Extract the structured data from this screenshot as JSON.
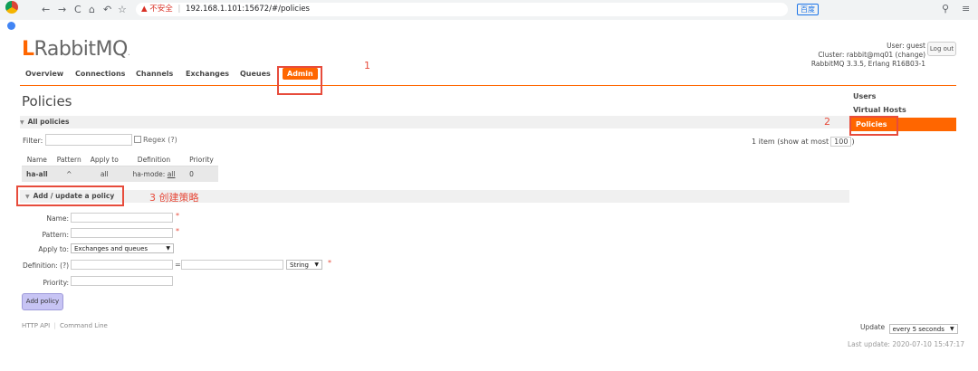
{
  "browser": {
    "nav_icons": [
      "←",
      "→",
      "C",
      "⌂",
      "↶",
      "☆"
    ],
    "warning": "▲ 不安全",
    "url": "192.168.1.101:15672/#/policies",
    "search_engine": "百度"
  },
  "logo": {
    "first": "L",
    "brand": "Rabbit",
    "mq": "MQ",
    "dot": "."
  },
  "user": {
    "line1": "User: guest",
    "line2": "Cluster: rabbit@mq01 (change)",
    "line3": "RabbitMQ 3.3.5, Erlang R16B03-1",
    "logout_label": "Log out"
  },
  "tabs": [
    "Overview",
    "Connections",
    "Channels",
    "Exchanges",
    "Queues",
    "Admin"
  ],
  "page_title": "Policies",
  "all_policies": {
    "header": "All policies",
    "filter_label": "Filter:",
    "regex_label": "Regex (?)",
    "items_text": "1 item (show at most",
    "items_max": "100",
    "items_close": ")",
    "columns": [
      "Name",
      "Pattern",
      "Apply to",
      "Definition",
      "Priority"
    ],
    "rows": [
      {
        "name": "ha-all",
        "pattern": "^",
        "apply_to": "all",
        "definition_key": "ha-mode:",
        "definition_val": "all",
        "priority": "0"
      }
    ]
  },
  "add_policy": {
    "header": "Add / update a policy",
    "fields": {
      "name": "Name:",
      "pattern": "Pattern:",
      "apply_to": "Apply to:",
      "definition": "Definition: (?)",
      "priority": "Priority:"
    },
    "apply_to_value": "Exchanges and queues",
    "definition_sep": "=",
    "definition_type": "String",
    "required_mark": "*",
    "button": "Add policy"
  },
  "annotations": {
    "one": "1",
    "two": "2",
    "three": "3 创建策略"
  },
  "sidebar": [
    "Users",
    "Virtual Hosts",
    "Policies"
  ],
  "footer": {
    "http_api": "HTTP API",
    "sep": "|",
    "command_line": "Command Line"
  },
  "update": {
    "label": "Update",
    "value": "every 5 seconds",
    "last": "Last update: 2020-07-10 15:47:17"
  },
  "colors": {
    "accent": "#ff6600",
    "annotation": "#e74c3c",
    "button": "#c7c4f4"
  }
}
